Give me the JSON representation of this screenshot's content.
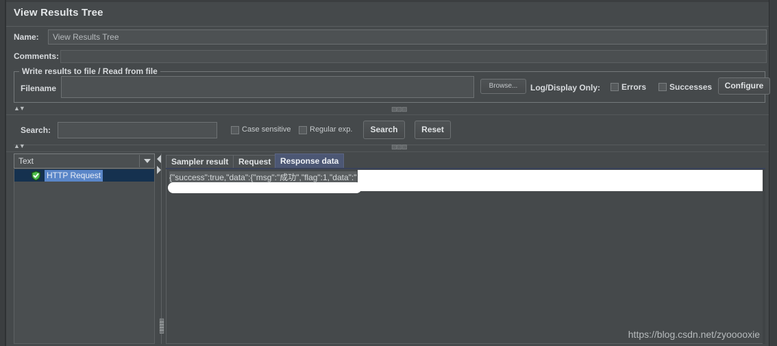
{
  "window": {
    "title": "View Results Tree"
  },
  "form": {
    "name_label": "Name:",
    "name_value": "View Results Tree",
    "comments_label": "Comments:",
    "comments_value": ""
  },
  "file_section": {
    "legend": "Write results to file / Read from file",
    "filename_label": "Filename",
    "filename_value": "",
    "browse_label": "Browse...",
    "log_display_label": "Log/Display Only:",
    "errors_label": "Errors",
    "errors_checked": false,
    "successes_label": "Successes",
    "successes_checked": false,
    "configure_label": "Configure"
  },
  "search_section": {
    "search_label": "Search:",
    "search_value": "",
    "case_sensitive_label": "Case sensitive",
    "case_sensitive_checked": false,
    "regular_exp_label": "Regular exp.",
    "regular_exp_checked": false,
    "search_button": "Search",
    "reset_button": "Reset"
  },
  "tree_panel": {
    "renderer_selected": "Text",
    "renderer_options": [
      "Text"
    ],
    "nodes": [
      {
        "label": "HTTP Request",
        "status": "success",
        "icon": "green-shield-check-icon",
        "selected": true
      }
    ]
  },
  "results_panel": {
    "tabs": [
      {
        "label": "Sampler result",
        "active": false
      },
      {
        "label": "Request",
        "active": false
      },
      {
        "label": "Response data",
        "active": true
      }
    ],
    "response_text": "{\"success\":true,\"data\":{\"msg\":\"成功\",\"flag\":1,\"data\":\""
  },
  "watermark": {
    "text": "https://blog.csdn.net/zyooooxie"
  },
  "colors": {
    "background": "#45494b",
    "panel_border": "#5d6163",
    "text": "#d8dbde",
    "selected_tab": "#4c5774",
    "tree_selection": "#5a86c8",
    "tree_row": "#15314f",
    "shield_green": "#3ea33e",
    "redaction": "#ffffff"
  }
}
